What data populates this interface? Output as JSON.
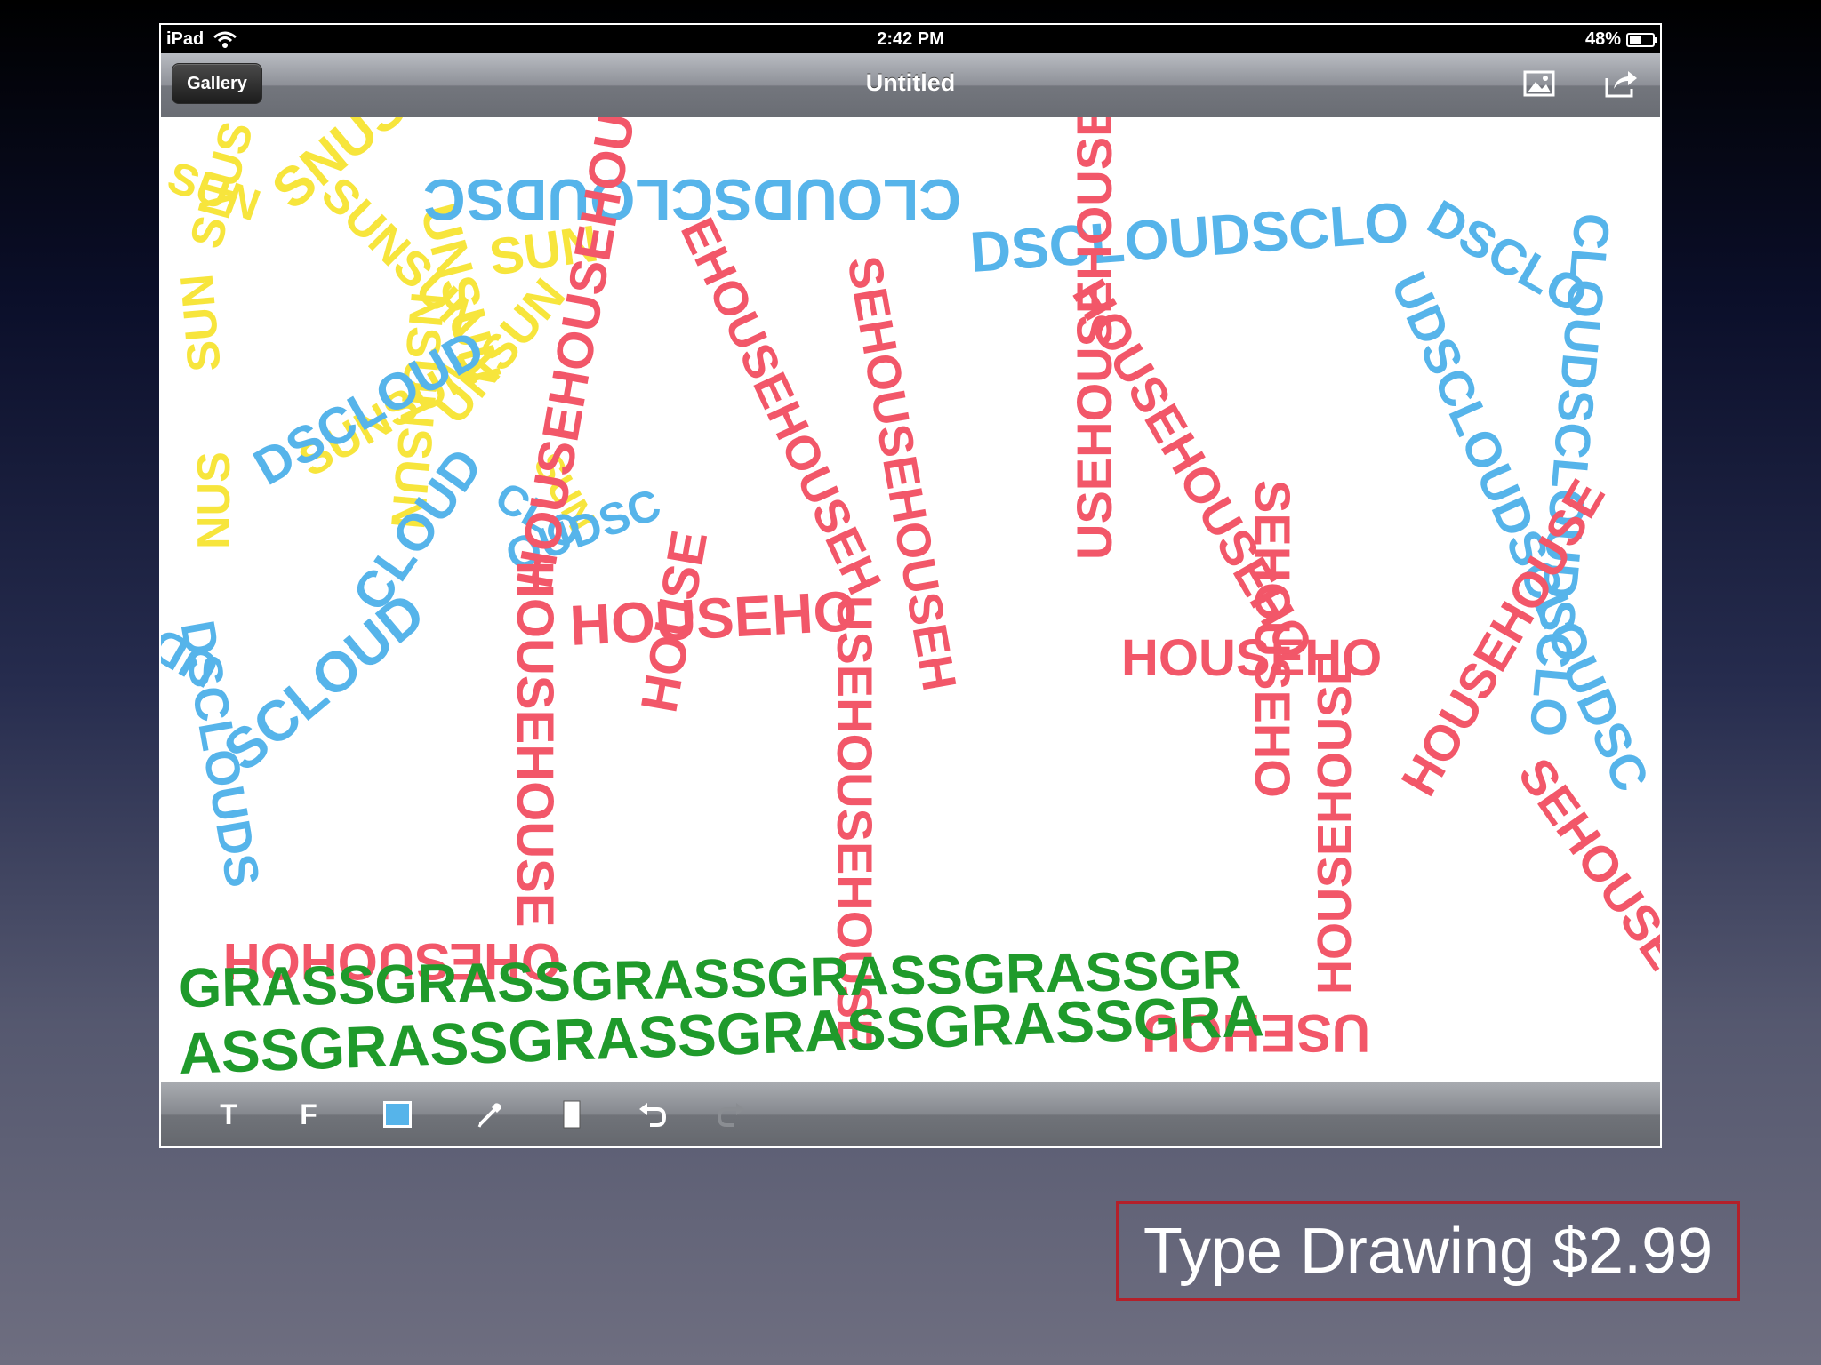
{
  "status_bar": {
    "device": "iPad",
    "time": "2:42 PM",
    "battery": "48%",
    "battery_level": 0.48
  },
  "nav_bar": {
    "back_label": "Gallery",
    "title": "Untitled",
    "icons": [
      "image-icon",
      "share-icon"
    ]
  },
  "drawing": {
    "sun": [
      "SUN",
      "SNUS",
      "SUNSUN",
      "UNSUN",
      "SUN",
      "NSUNSUN",
      "UNSUN",
      "SUNSUN",
      "SUN",
      "SNUS",
      "NUS",
      "SUN"
    ],
    "cloud_left": [
      "DSCLOUD",
      "SCLOUD",
      "DSCLOUDS",
      "CLOUD",
      "UDSCL",
      "OUDSC",
      "CLO"
    ],
    "cloud_right": [
      "CLOUDSCLOUDSC",
      "DSCLOUDSCLO",
      "UDSCLOUDSCLOUDSC",
      "CLOUDSCLOUDSCLO",
      "DSCLO"
    ],
    "house_big": [
      "HOUSEHOUSEHOUSE",
      "EHOUSEHOUSEH",
      "SEHOUSEHOUSEH",
      "HOUSEHOUSE",
      "HOUSEHO",
      "USEHOUSEHOUSE",
      "HOUSE",
      "OHESUOHOH"
    ],
    "house_right": [
      "HOUSEHOUSEHO",
      "USEHOUSEHOUSE",
      "SEHOUSEHO",
      "HOUSEHO"
    ],
    "house_small": [
      "HOUSEHOUSE",
      "SEHOUSE",
      "HOUSEHOUSE",
      "USEHOU"
    ],
    "grass": [
      "GRASSGRASSGRASSGRASSGRASSGR",
      "ASSGRASSGRASSGRASSGRASSGRA"
    ]
  },
  "toolbar": {
    "text_tool_label": "T",
    "font_tool_label": "F",
    "color": "#56b4ea",
    "icons": [
      "color-swatch",
      "eyedropper-icon",
      "eraser-icon",
      "undo-icon",
      "redo-icon"
    ]
  },
  "caption": "Type Drawing $2.99",
  "colors": {
    "sun": "#f7e53c",
    "cloud": "#56b4ea",
    "house": "#f25769",
    "grass": "#1f9a2b",
    "caption_border": "#b3202a"
  }
}
